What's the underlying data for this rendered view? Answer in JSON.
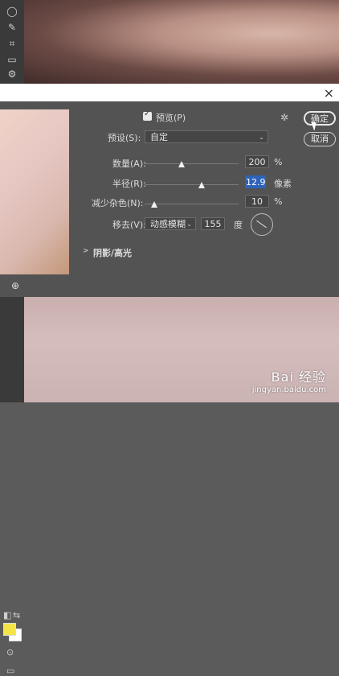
{
  "dialog": {
    "preview": {
      "label": "预览(P)"
    },
    "preset": {
      "label": "预设(S):",
      "value": "自定"
    },
    "amount": {
      "label": "数量(A):",
      "value": "200",
      "unit": "%",
      "level_percent": 40
    },
    "radius": {
      "label": "半径(R):",
      "value": "12.9",
      "unit": "像素",
      "level_percent": 60
    },
    "noise": {
      "label": "减少杂色(N):",
      "value": "10",
      "unit": "%",
      "level_percent": 10
    },
    "remove": {
      "label": "移去(V):",
      "type": "动感模糊",
      "angle": "155",
      "angle_unit": "度"
    },
    "shadows": {
      "label": "阴影/高光"
    },
    "buttons": {
      "ok": "确定",
      "cancel": "取消"
    }
  },
  "watermark": {
    "line1": "Bai 经验",
    "line2": "jingyan.baidu.com"
  },
  "colors": {
    "foreground": "#f3e44a",
    "background": "#ffffff",
    "accent": "#2d63b8"
  },
  "icons": [
    "lasso-icon",
    "quick-select-icon",
    "crop-icon",
    "ruler-icon",
    "gear-icon",
    "zoom-icon",
    "swap-colors-icon",
    "quick-mask-icon",
    "screen-mode-icon",
    "close-icon"
  ]
}
